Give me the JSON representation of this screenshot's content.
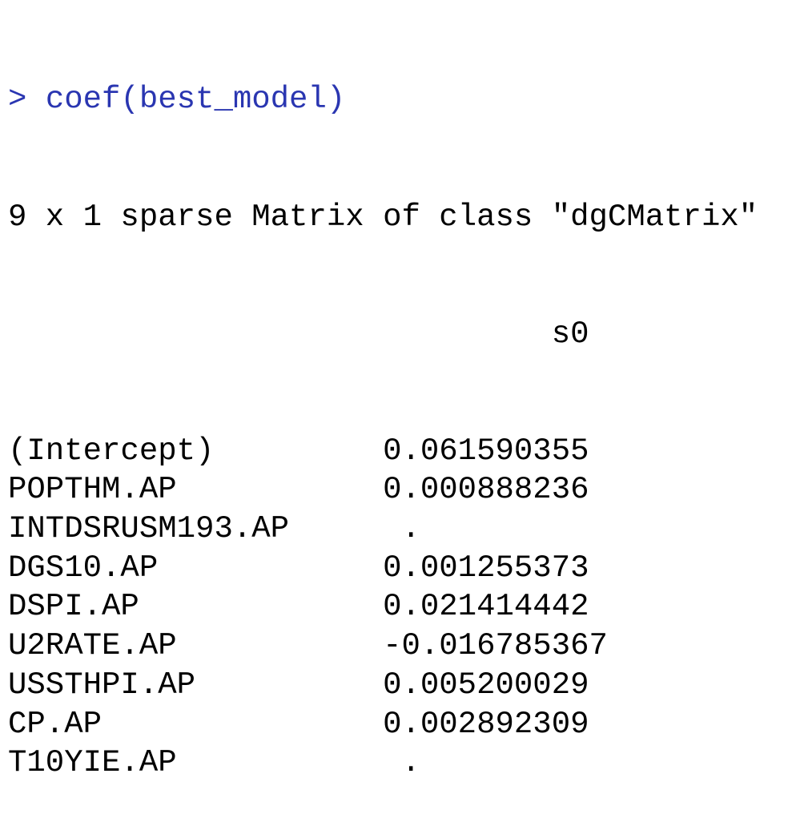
{
  "console": {
    "prompt": "> ",
    "command": "coef(best_model)",
    "header": "9 x 1 sparse Matrix of class \"dgCMatrix\"",
    "column_header": "s0",
    "rows": [
      {
        "name": "(Intercept)",
        "value": "0.061590355"
      },
      {
        "name": "POPTHM.AP",
        "value": "0.000888236"
      },
      {
        "name": "INTDSRUSM193.AP",
        "value": "."
      },
      {
        "name": "DGS10.AP",
        "value": "0.001255373"
      },
      {
        "name": "DSPI.AP",
        "value": "0.021414442"
      },
      {
        "name": "U2RATE.AP",
        "value": "-0.016785367"
      },
      {
        "name": "USSTHPI.AP",
        "value": "0.005200029"
      },
      {
        "name": "CP.AP",
        "value": "0.002892309"
      },
      {
        "name": "T10YIE.AP",
        "value": "."
      }
    ]
  },
  "colors": {
    "command": "#2a36b1",
    "output": "#000000",
    "background": "#ffffff"
  }
}
